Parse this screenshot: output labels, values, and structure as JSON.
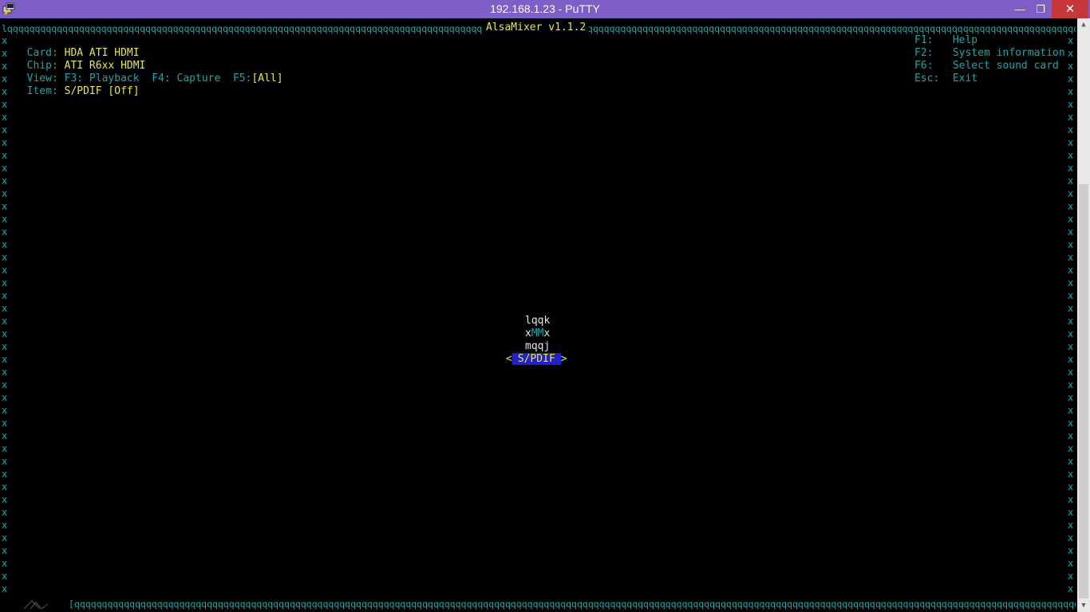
{
  "window": {
    "title": "192.168.1.23 - PuTTY",
    "minimize_glyph": "—",
    "maximize_glyph": "❐",
    "close_glyph": "✕",
    "icon": "putty-terminal-icon"
  },
  "alsamixer": {
    "title": "AlsaMixer v1.1.2",
    "card_label": "Card:",
    "card_value": "HDA ATI HDMI",
    "chip_label": "Chip:",
    "chip_value": "ATI R6xx HDMI",
    "view_label": "View:",
    "view_f3": "F3: Playback",
    "view_f4": "F4: Capture",
    "view_f5_key": "F5:",
    "view_f5_value": "[All]",
    "item_label": "Item:",
    "item_value": "S/PDIF [Off]",
    "help": [
      {
        "key": "F1:",
        "text": "Help"
      },
      {
        "key": "F2:",
        "text": "System information"
      },
      {
        "key": "F6:",
        "text": "Select sound card"
      },
      {
        "key": "Esc:",
        "text": "Exit"
      }
    ],
    "control": {
      "top": "lqqk",
      "mid_left": "x",
      "mid_mute": "MM",
      "mid_right": "x",
      "bottom": "mqqj",
      "left_arrow": "<",
      "name": "S/PDIF",
      "right_arrow": ">"
    },
    "border_char": "q",
    "side_char": "x"
  },
  "colors": {
    "titlebar": "#7e5fc7",
    "close": "#c7373a",
    "cyan": "#19a7a7",
    "yellow": "#e8e840",
    "selected_bg": "#2020d0"
  }
}
